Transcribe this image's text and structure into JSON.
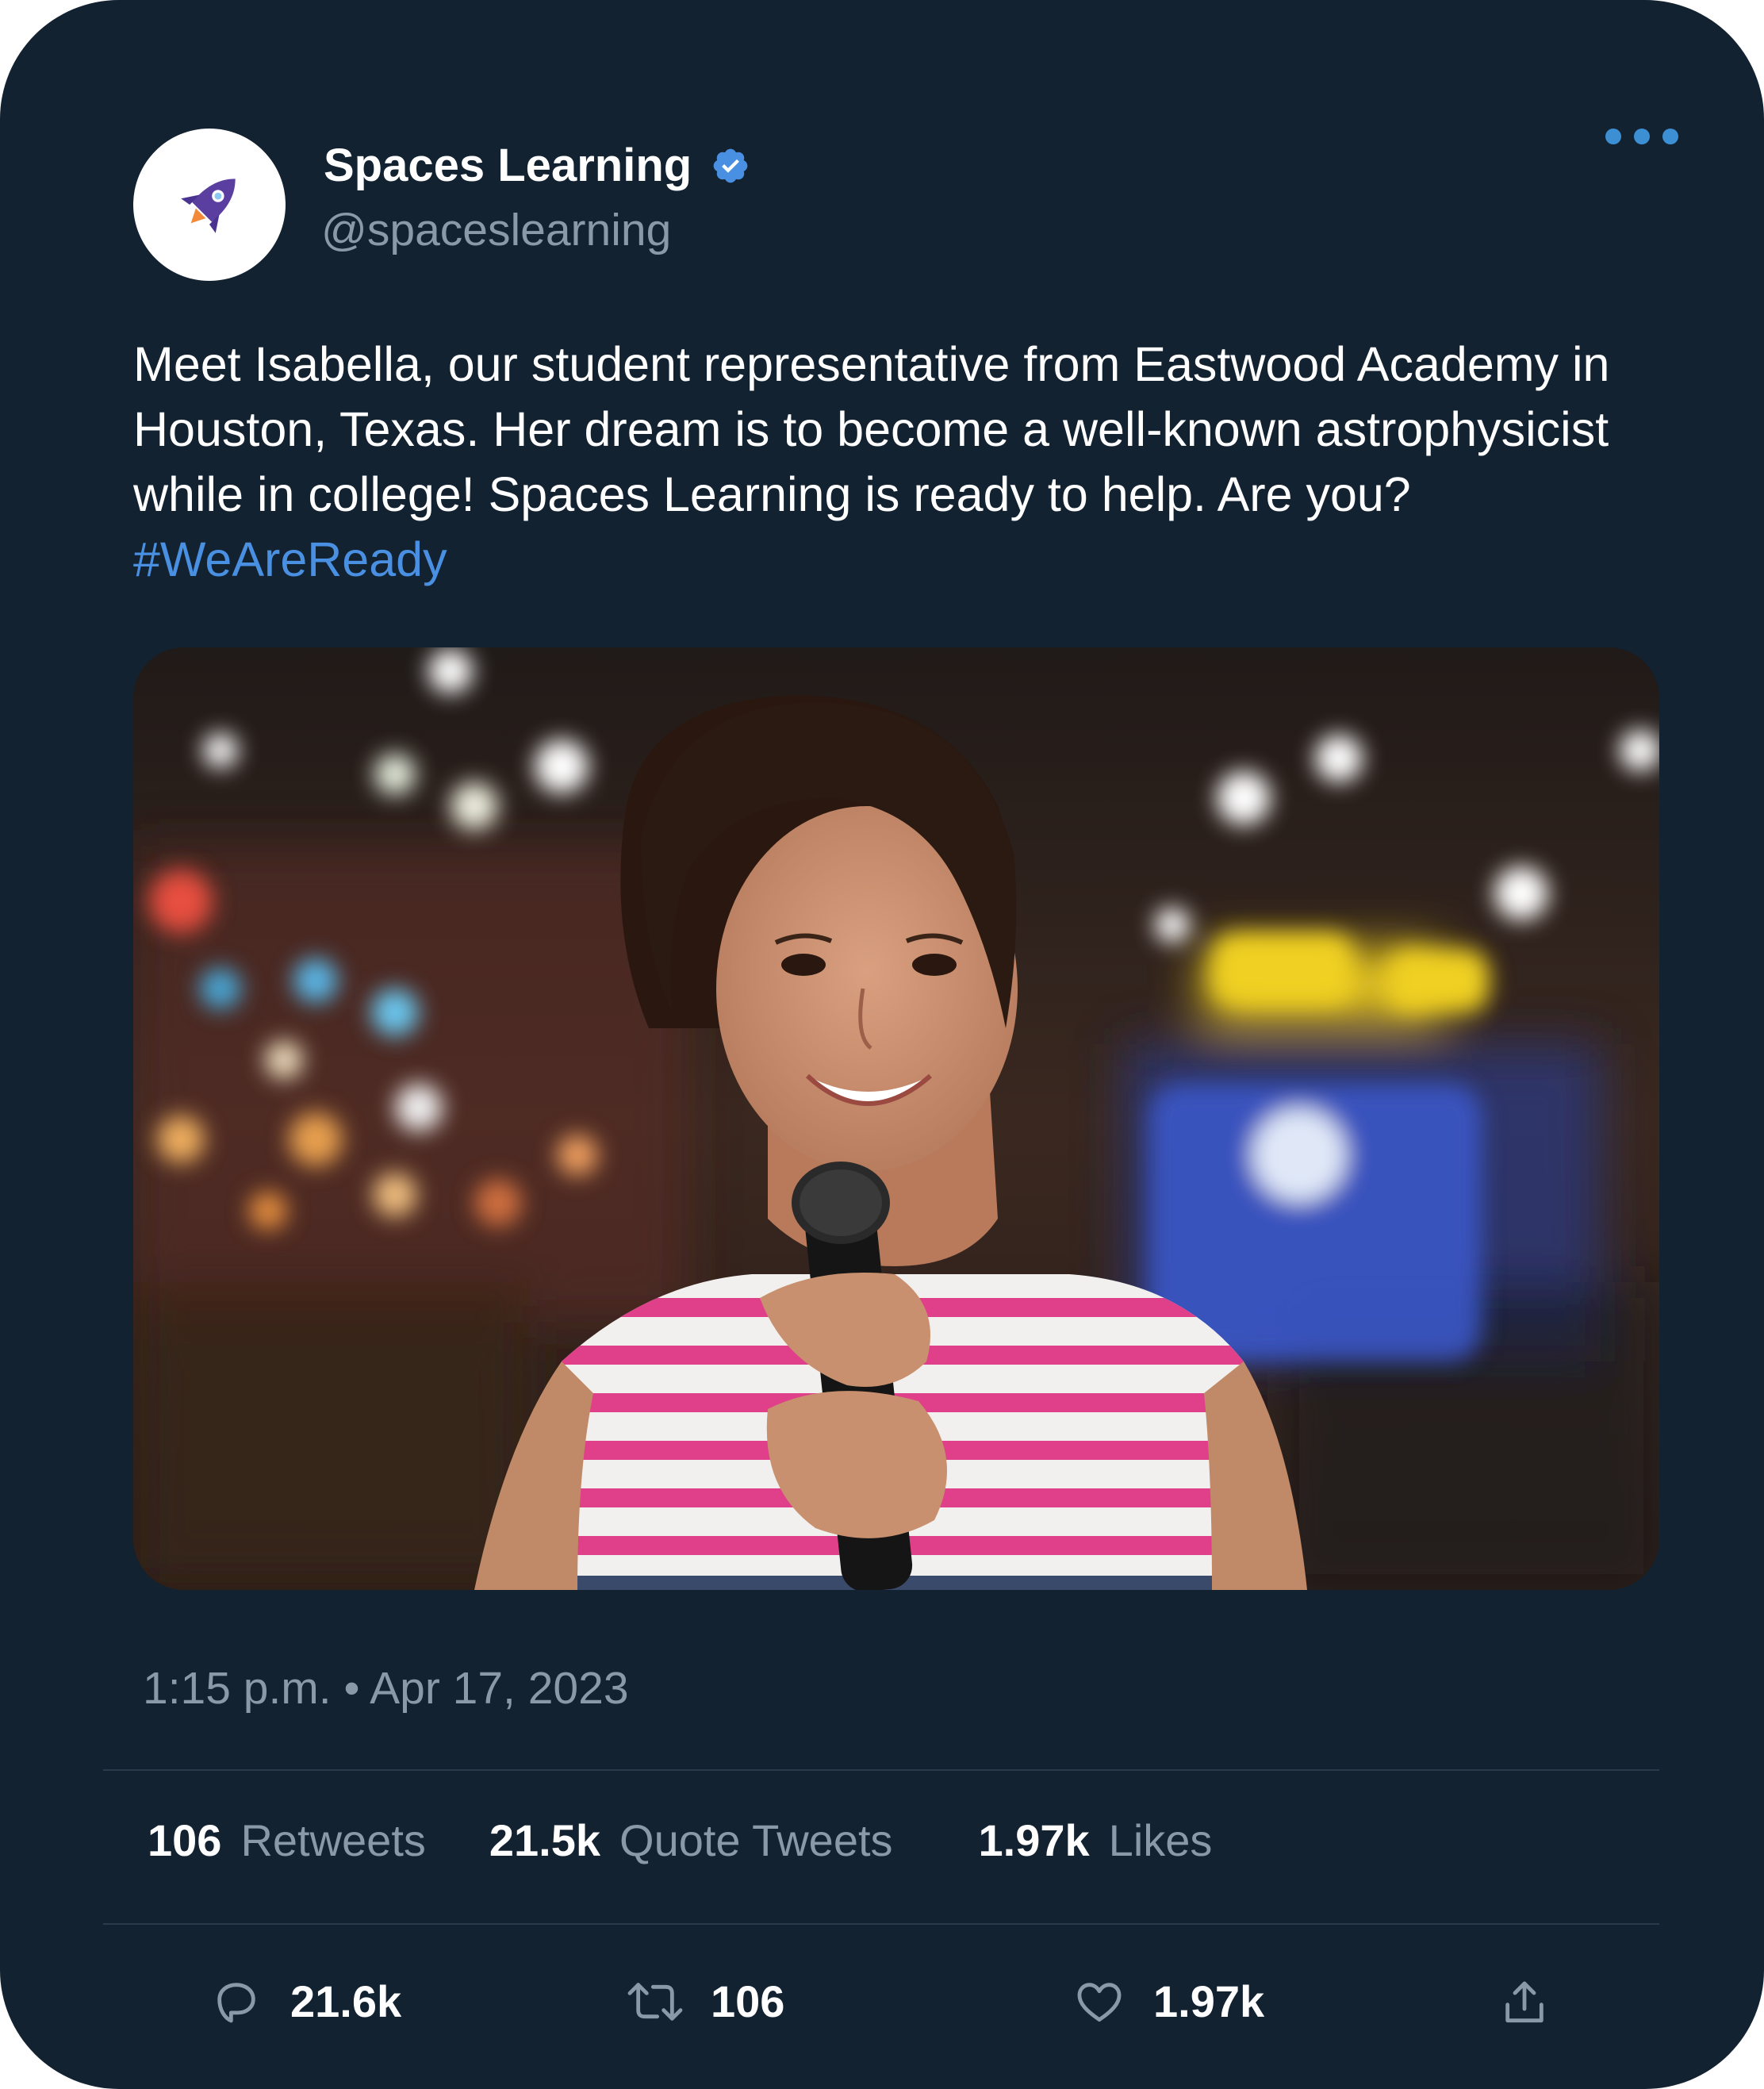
{
  "author": {
    "display_name": "Spaces Learning",
    "handle": "@spaceslearning",
    "verified": true,
    "avatar_icon": "rocket-icon"
  },
  "tweet": {
    "text": "Meet Isabella, our student representative from Eastwood Academy in Houston, Texas. Her dream is to become a well-known astrophysicist while in college! Spaces Learning is ready to help. Are you? ",
    "hashtag": "#WeAreReady"
  },
  "media": {
    "icon": "photo-student-with-microphone"
  },
  "timestamp": "1:15 p.m. • Apr 17, 2023",
  "stats": {
    "retweets": {
      "value": "106",
      "label": "Retweets"
    },
    "quote_tweets": {
      "value": "21.5k",
      "label": "Quote Tweets"
    },
    "likes": {
      "value": "1.97k",
      "label": "Likes"
    }
  },
  "actions": {
    "reply": {
      "icon": "reply-icon",
      "count": "21.6k"
    },
    "retweet": {
      "icon": "retweet-icon",
      "count": "106"
    },
    "like": {
      "icon": "heart-icon",
      "count": "1.97k"
    },
    "share": {
      "icon": "share-icon"
    }
  },
  "colors": {
    "background": "#132231",
    "accent": "#4a90e2",
    "muted_text": "#8a99a8",
    "verified_badge": "#4a90e2",
    "more_dots": "#3d8fd4"
  }
}
